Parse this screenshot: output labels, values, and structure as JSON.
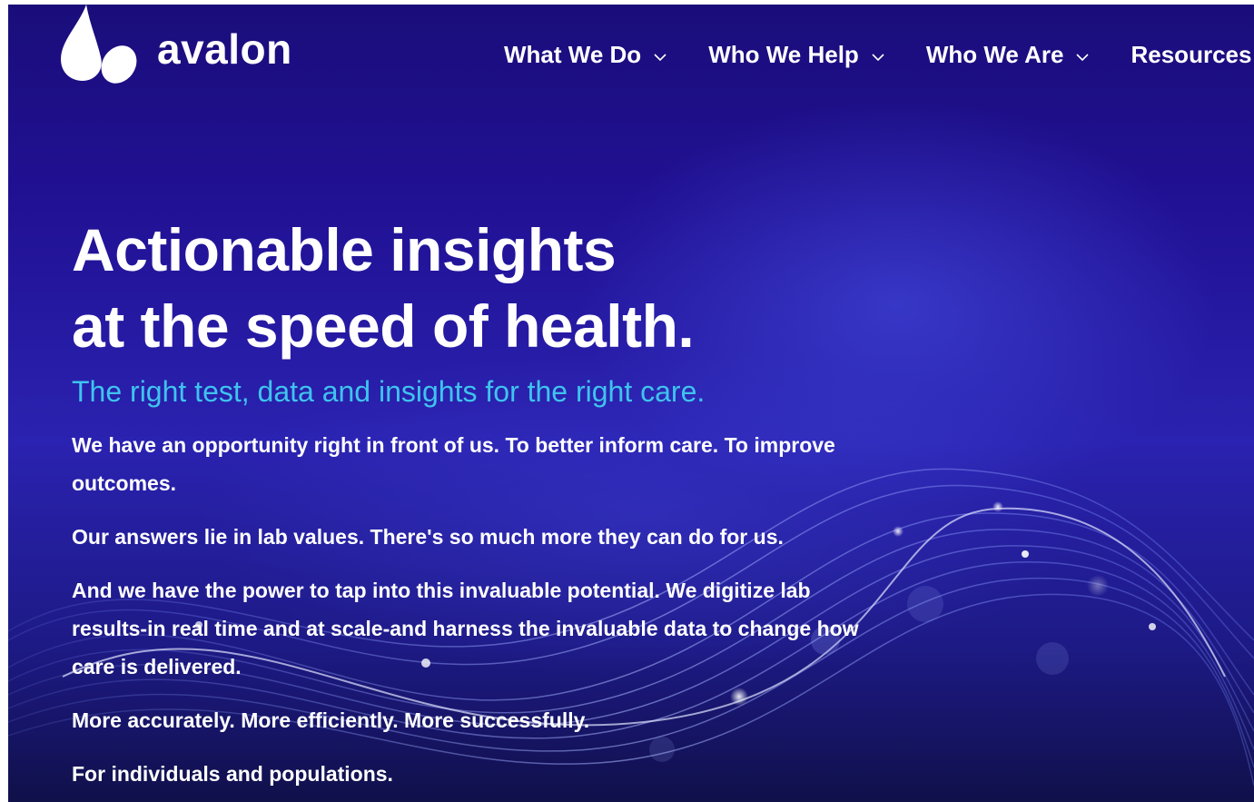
{
  "nav": {
    "logo_text": "avalon",
    "items": [
      {
        "label": "What We Do",
        "has_dropdown": true
      },
      {
        "label": "Who We Help",
        "has_dropdown": true
      },
      {
        "label": "Who We Are",
        "has_dropdown": true
      },
      {
        "label": "Resources",
        "has_dropdown": false
      }
    ]
  },
  "hero": {
    "headline_line1": "Actionable insights",
    "headline_line2": "at the speed of health.",
    "subhead": "The right test, data and insights for the right care.",
    "paragraphs": [
      "We have an opportunity right in front of us. To better inform care. To improve outcomes.",
      "Our answers lie in lab values. There's so much more they can do for us.",
      "And we have the power to tap into this invaluable potential. We digitize lab results-in real time and at scale-and harness the invaluable data to change how care is delivered.",
      "More accurately. More efficiently. More successfully.",
      "For individuals and populations."
    ]
  },
  "colors": {
    "background": "#211194",
    "subhead": "#3fc3ee",
    "text": "#ffffff"
  },
  "icons": {
    "logo": "avalon-droplet-logo-icon",
    "dropdown": "chevron-down-icon"
  }
}
